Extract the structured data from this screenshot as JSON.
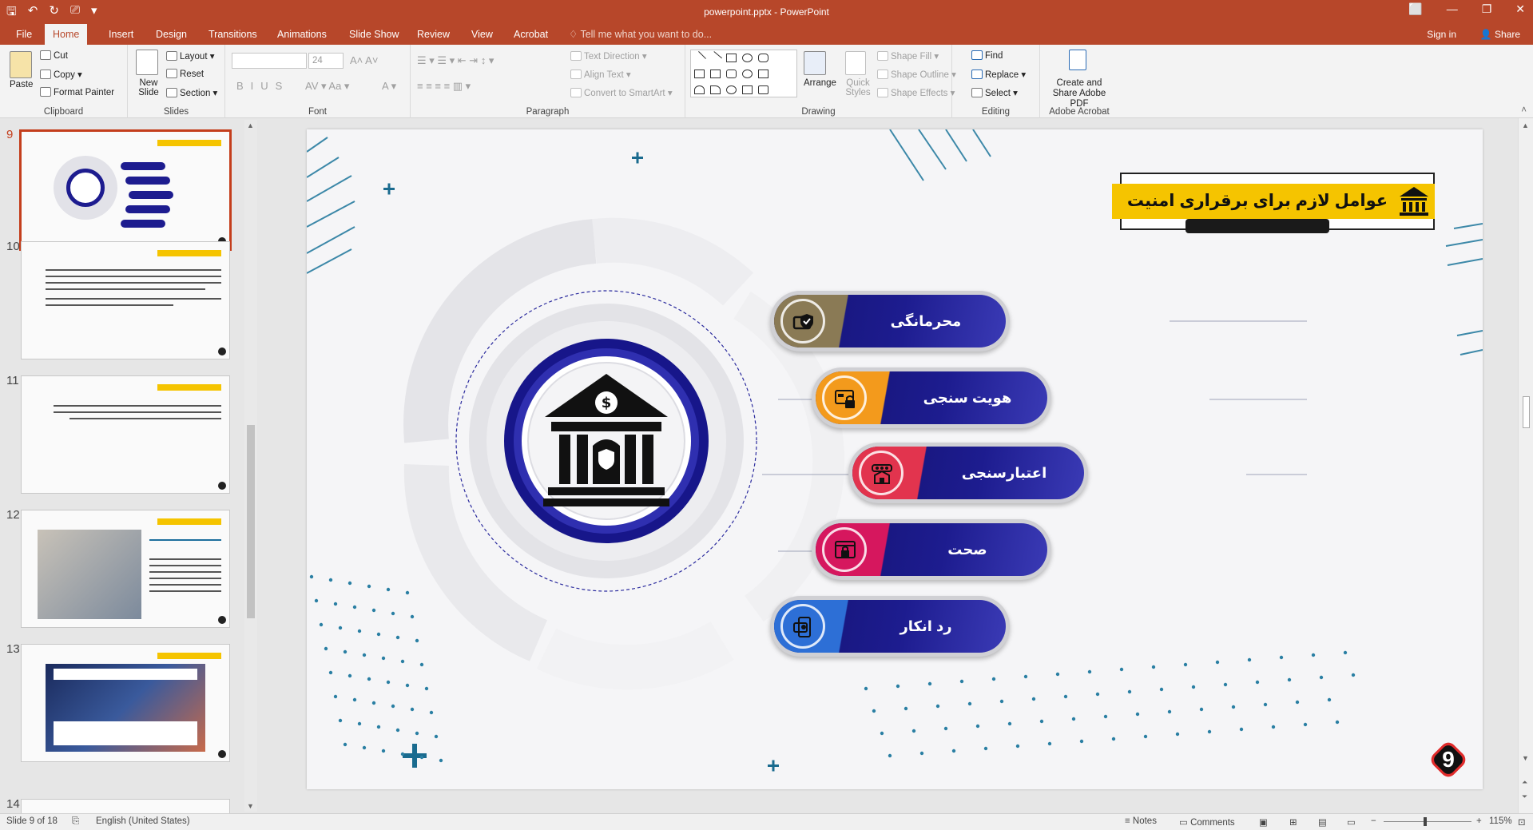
{
  "window": {
    "doc_title": "powerpoint.pptx - PowerPoint",
    "controls": [
      "?",
      "⬜",
      "—",
      "❐",
      "✕"
    ]
  },
  "tabs": [
    "File",
    "Home",
    "Insert",
    "Design",
    "Transitions",
    "Animations",
    "Slide Show",
    "Review",
    "View",
    "Acrobat"
  ],
  "active_tab": "Home",
  "tell_me": "Tell me what you want to do...",
  "account": {
    "sign_in": "Sign in",
    "share": "Share"
  },
  "ribbon": {
    "clipboard": {
      "paste": "Paste",
      "cut": "Cut",
      "copy": "Copy",
      "format_painter": "Format Painter",
      "label": "Clipboard"
    },
    "slides": {
      "new_slide": "New Slide",
      "layout": "Layout",
      "reset": "Reset",
      "section": "Section",
      "label": "Slides"
    },
    "font": {
      "font_name": "",
      "font_size": "24",
      "label": "Font"
    },
    "paragraph": {
      "text_direction": "Text Direction",
      "align_text": "Align Text",
      "convert_smartart": "Convert to SmartArt",
      "label": "Paragraph"
    },
    "drawing": {
      "arrange": "Arrange",
      "quick_styles": "Quick Styles",
      "shape_fill": "Shape Fill",
      "shape_outline": "Shape Outline",
      "shape_effects": "Shape Effects",
      "label": "Drawing"
    },
    "editing": {
      "find": "Find",
      "replace": "Replace",
      "select": "Select",
      "label": "Editing"
    },
    "acrobat": {
      "create_share": "Create and Share Adobe PDF",
      "label": "Adobe Acrobat"
    }
  },
  "thumbnails": [
    {
      "number": "9",
      "active": true
    },
    {
      "number": "10",
      "active": false
    },
    {
      "number": "11",
      "active": false
    },
    {
      "number": "12",
      "active": false
    },
    {
      "number": "13",
      "active": false
    },
    {
      "number": "14",
      "active": false
    }
  ],
  "slide": {
    "title": "عوامل لازم برای برقراری امنیت",
    "items": [
      {
        "label": "محرمانگی",
        "cap_color": "#8a7a55",
        "icon": "id-card-shield-icon"
      },
      {
        "label": "هویت سنجی",
        "cap_color": "#f39a1c",
        "icon": "credit-card-lock-icon"
      },
      {
        "label": "اعتبارسنجی",
        "cap_color": "#e2344e",
        "icon": "shop-check-icon"
      },
      {
        "label": "صحت",
        "cap_color": "#d6175e",
        "icon": "browser-lock-icon"
      },
      {
        "label": "رد انکار",
        "cap_color": "#2d6fd6",
        "icon": "phone-card-icon"
      }
    ],
    "center_icon": "bank-dollar-icon",
    "page_number": "9"
  },
  "status": {
    "slide_of": "Slide 9 of 18",
    "language": "English (United States)",
    "notes": "Notes",
    "comments": "Comments",
    "zoom": "115%"
  }
}
